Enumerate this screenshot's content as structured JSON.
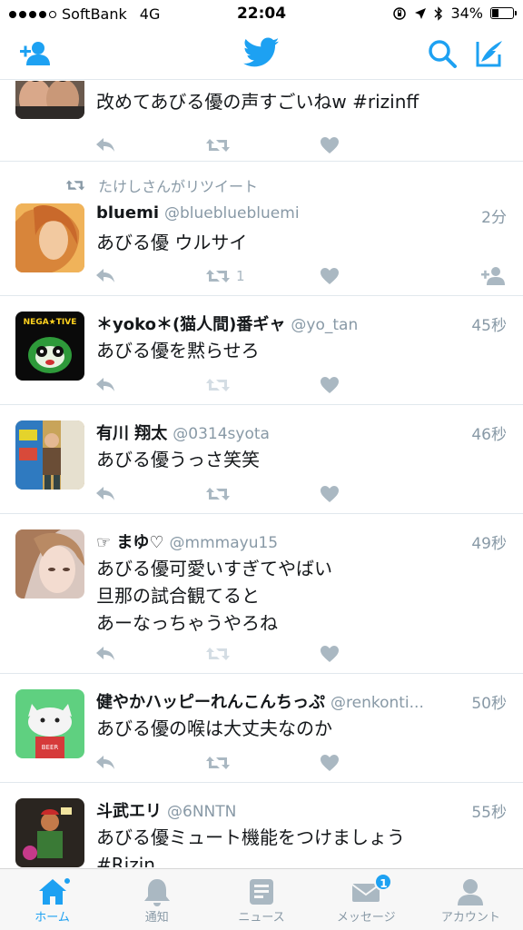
{
  "status_bar": {
    "carrier": "SoftBank",
    "network": "4G",
    "time": "22:04",
    "battery": "34%",
    "battery_level": 0.34
  },
  "nav": {
    "brand_color": "#1da1f2"
  },
  "tweets": [
    {
      "name": "",
      "handle": "",
      "time": "",
      "text": "改めてあびる優の声すごいねw #rizinff",
      "retweets": "",
      "retweeted_by": ""
    },
    {
      "name": "bluemi",
      "handle": "@bluebluebluemi",
      "time": "2分",
      "text": "あびる優 ウルサイ",
      "retweets": "1",
      "retweeted_by": "たけしさんがリツイート"
    },
    {
      "name": "＊yoko＊(猫人間)番ギャ",
      "handle": "@yo_tan",
      "time": "45秒",
      "text": "あびる優を黙らせろ",
      "retweets": "",
      "retweeted_by": ""
    },
    {
      "name": "有川 翔太",
      "handle": "@0314syota",
      "time": "46秒",
      "text": "あびる優うっさ笑笑",
      "retweets": "",
      "retweeted_by": ""
    },
    {
      "name": "☞ まゆ♡",
      "handle": "@mmmayu15",
      "time": "49秒",
      "text": "あびる優可愛いすぎてやばい\n旦那の試合観てると\nあーなっちゃうやろね",
      "retweets": "",
      "retweeted_by": ""
    },
    {
      "name": "健やかハッピーれんこんちっぷ",
      "handle": "@renkonti...",
      "time": "50秒",
      "text": "あびる優の喉は大丈夫なのか",
      "retweets": "",
      "retweeted_by": ""
    },
    {
      "name": "斗武エリ",
      "handle": "@6NNTN",
      "time": "55秒",
      "text": "あびる優ミュート機能をつけましょう\n #Rizin",
      "retweets": "",
      "retweeted_by": ""
    }
  ],
  "tabs": [
    {
      "label": "ホーム",
      "icon": "home-icon"
    },
    {
      "label": "通知",
      "icon": "bell-icon"
    },
    {
      "label": "ニュース",
      "icon": "news-icon"
    },
    {
      "label": "メッセージ",
      "icon": "envelope-icon",
      "badge": "1"
    },
    {
      "label": "アカウント",
      "icon": "person-icon"
    }
  ]
}
